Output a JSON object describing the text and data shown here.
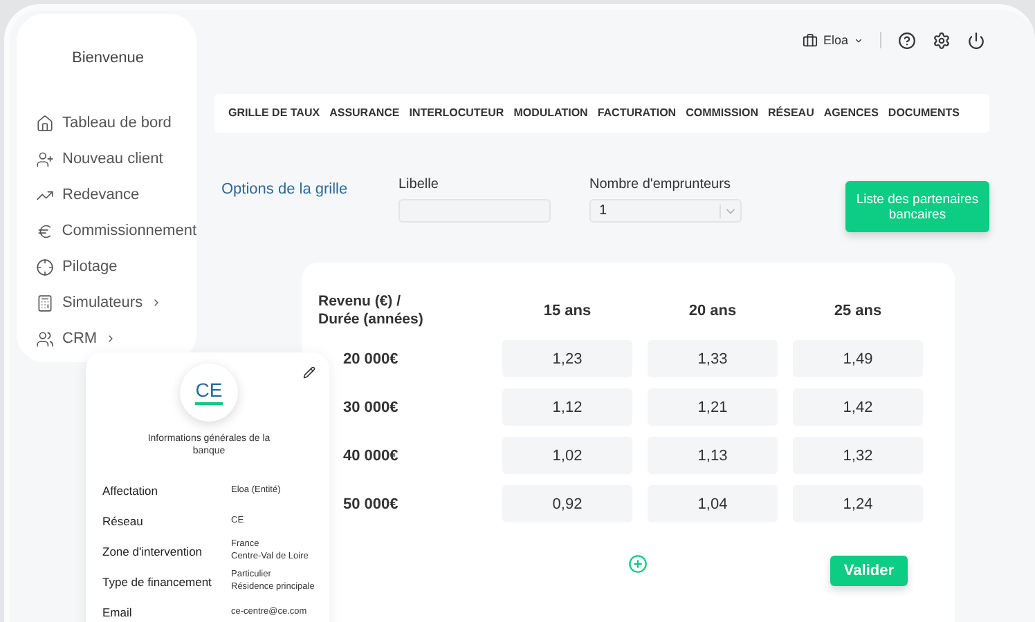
{
  "sidebar": {
    "greeting": "Bienvenue",
    "items": [
      {
        "label": "Tableau de bord",
        "submenu": false
      },
      {
        "label": "Nouveau client",
        "submenu": false
      },
      {
        "label": "Redevance",
        "submenu": false
      },
      {
        "label": "Commissionnement",
        "submenu": false
      },
      {
        "label": "Pilotage",
        "submenu": false
      },
      {
        "label": "Simulateurs",
        "submenu": true
      },
      {
        "label": "CRM",
        "submenu": true
      }
    ]
  },
  "header": {
    "user": "Eloa"
  },
  "tabs": [
    {
      "label": "GRILLE DE TAUX",
      "selected": false
    },
    {
      "label": "ASSURANCE",
      "selected": false
    },
    {
      "label": "INTERLOCUTEUR",
      "selected": false
    },
    {
      "label": "MODULATION",
      "selected": false
    },
    {
      "label": "FACTURATION",
      "selected": false
    },
    {
      "label": "COMMISSION",
      "selected": false
    },
    {
      "label": "RÉSEAU",
      "selected": false
    },
    {
      "label": "AGENCES",
      "selected": false
    },
    {
      "label": "DOCUMENTS",
      "selected": false
    }
  ],
  "options": {
    "title": "Options de la grille",
    "libelle": {
      "label": "Libelle"
    },
    "borrowers": {
      "label": "Nombre d'emprunteurs",
      "value": "1"
    },
    "partners_button": "Liste des partenaires bancaires"
  },
  "grid": {
    "corner": "Revenu (€) / Durée (années)",
    "columns": [
      "15 ans",
      "20 ans",
      "25 ans"
    ],
    "rows": [
      {
        "label": "20 000€",
        "values": [
          "1,23",
          "1,33",
          "1,49"
        ]
      },
      {
        "label": "30 000€",
        "values": [
          "1,12",
          "1,21",
          "1,42"
        ]
      },
      {
        "label": "40 000€",
        "values": [
          "1,02",
          "1,13",
          "1,32"
        ]
      },
      {
        "label": "50 000€",
        "values": [
          "0,92",
          "1,04",
          "1,24"
        ]
      }
    ],
    "submit": "Valider"
  },
  "bank_card": {
    "initials": "CE",
    "subtitle": "Informations générales de la banque",
    "fields": [
      {
        "label": "Affectation",
        "value": [
          "Eloa (Entité)"
        ]
      },
      {
        "label": "Réseau",
        "value": [
          "CE"
        ]
      },
      {
        "label": "Zone d'intervention",
        "value": [
          "France",
          "Centre-Val de Loire"
        ]
      },
      {
        "label": "Type de financement",
        "value": [
          "Particulier",
          "Résidence principale"
        ]
      },
      {
        "label": "Email",
        "value": [
          "ce-centre@ce.com"
        ]
      }
    ]
  }
}
